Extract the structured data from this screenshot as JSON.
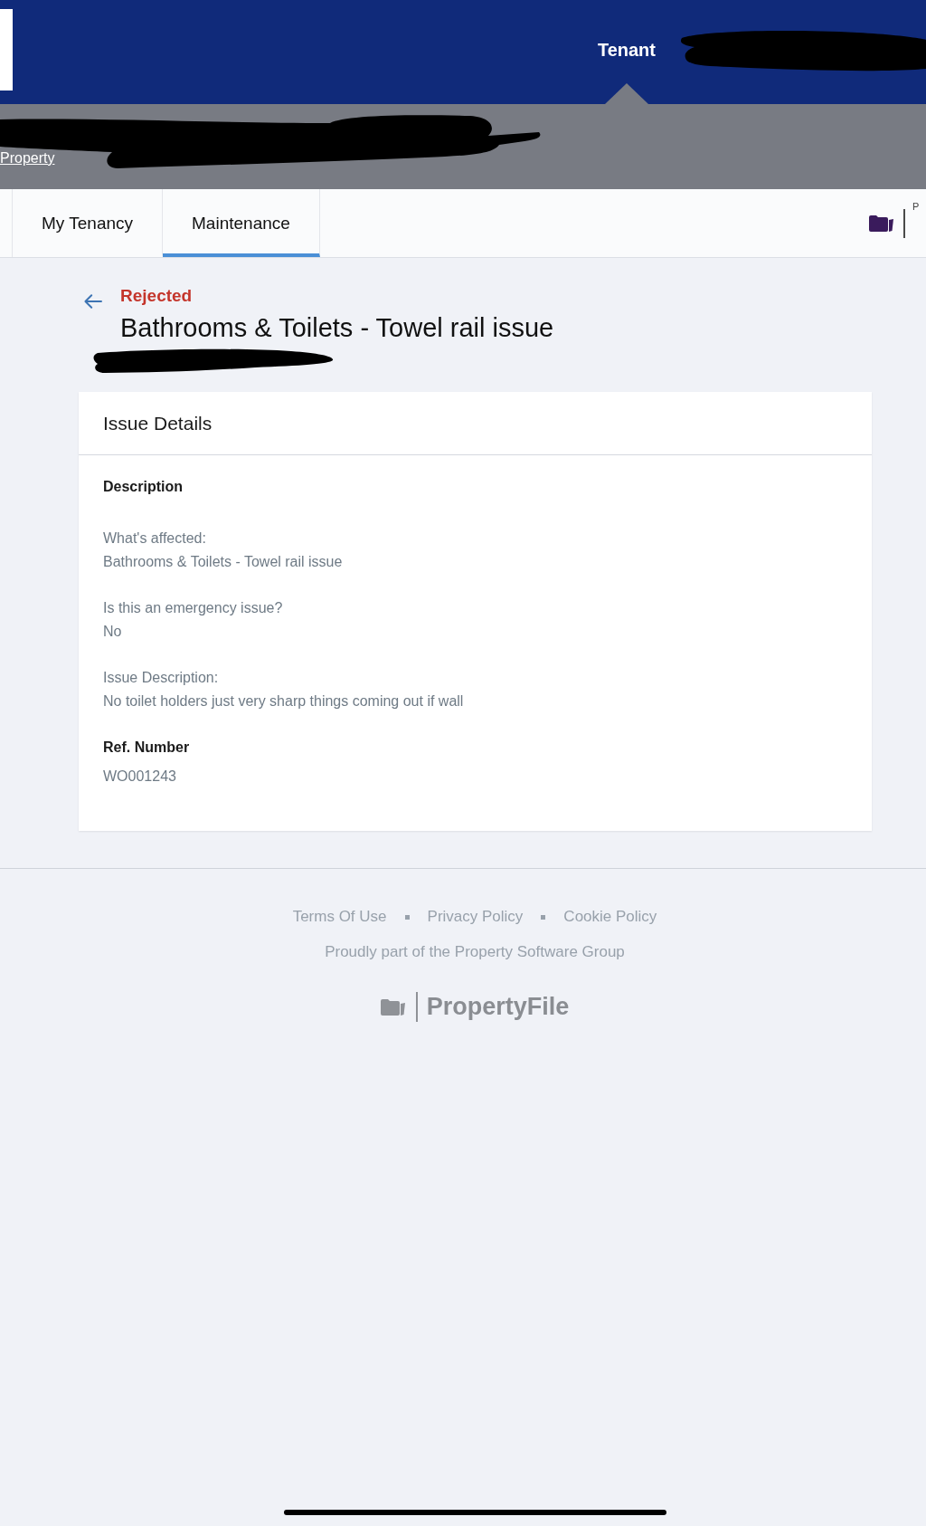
{
  "top_bar": {
    "nav": [
      {
        "label": "Tenant",
        "selected": true
      }
    ]
  },
  "breadcrumb": {
    "link": "Property"
  },
  "tabs": [
    {
      "label": "My Tenancy",
      "selected": false
    },
    {
      "label": "Maintenance",
      "selected": true
    }
  ],
  "tab_bar_logo": {
    "text": "P"
  },
  "issue": {
    "status": {
      "label": "Rejected",
      "kind": "rejected"
    },
    "title": "Bathrooms & Toilets - Towel rail issue"
  },
  "issue_details": {
    "title": "Issue Details",
    "sections": [
      {
        "heading": "Description",
        "fields": [
          {
            "label": "What's affected:",
            "value": "Bathrooms & Toilets - Towel rail issue"
          },
          {
            "label": "Is this an emergency issue?",
            "value": "No"
          },
          {
            "label": "Issue Description:",
            "value": "No toilet holders just very sharp things coming out if wall"
          }
        ]
      },
      {
        "heading": "Ref. Number",
        "fields": [
          {
            "value": "WO001243"
          }
        ]
      }
    ]
  },
  "footer": {
    "links": [
      "Terms Of Use",
      "Privacy Policy",
      "Cookie Policy"
    ],
    "tagline": "Proudly part of the Property Software Group",
    "logo": "PropertyFile"
  }
}
